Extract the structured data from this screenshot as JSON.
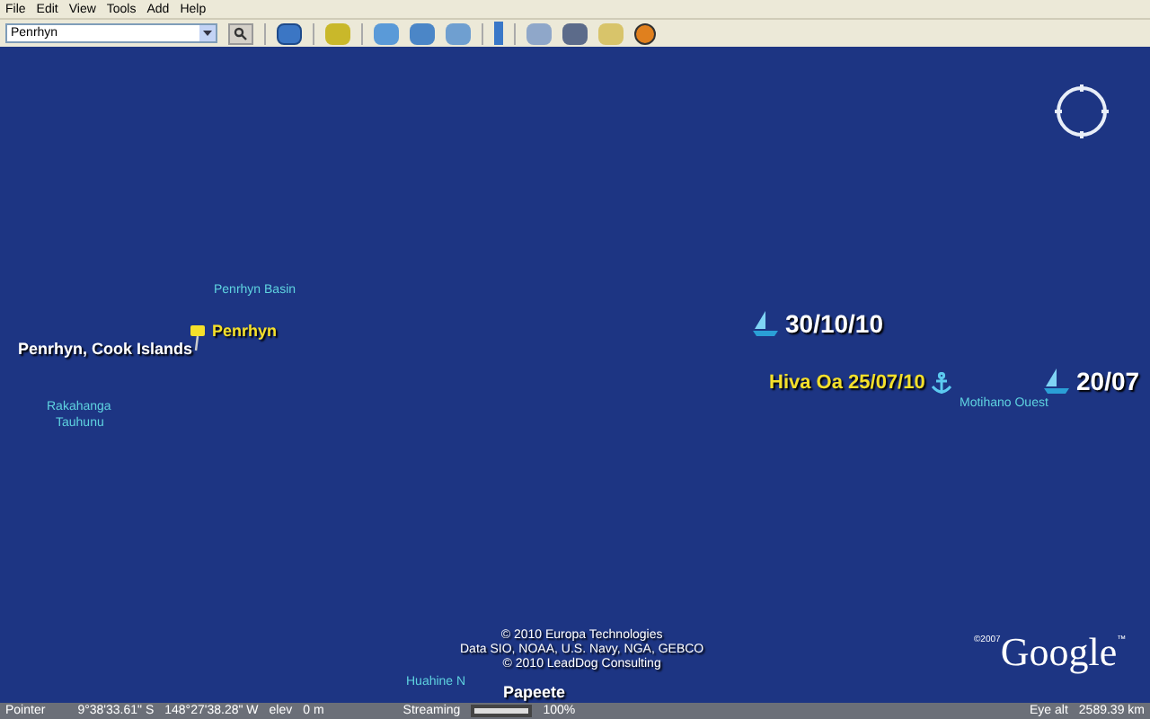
{
  "menu": [
    "File",
    "Edit",
    "View",
    "Tools",
    "Add",
    "Help"
  ],
  "search": {
    "value": "Penrhyn"
  },
  "map": {
    "labels": [
      {
        "kind": "feature",
        "text": "Penrhyn Basin"
      },
      {
        "kind": "pin",
        "text": "Penrhyn"
      },
      {
        "kind": "place",
        "text": "Penrhyn, Cook Islands"
      },
      {
        "kind": "feature",
        "text": "Rakahanga"
      },
      {
        "kind": "feature",
        "text": "Tauhunu"
      },
      {
        "kind": "boat",
        "text": "30/10/10"
      },
      {
        "kind": "anchor",
        "text": "Hiva Oa 25/07/10"
      },
      {
        "kind": "feature",
        "text": "Motihano Ouest"
      },
      {
        "kind": "boat",
        "text": "20/07"
      },
      {
        "kind": "feature",
        "text": "Huahine N"
      },
      {
        "kind": "place",
        "text": "Papeete"
      }
    ],
    "copyright": [
      "© 2010 Europa Technologies",
      "Data SIO, NOAA, U.S. Navy, NGA, GEBCO",
      "© 2010 LeadDog Consulting"
    ],
    "logo": {
      "year": "©2007",
      "name": "Google",
      "tm": "™"
    }
  },
  "status_bar": {
    "pointer_label": "Pointer",
    "lat": "9°38'33.61\" S",
    "lon": "148°27'38.28\" W",
    "elev_label": "elev",
    "elev": "0 m",
    "streaming_label": "Streaming",
    "level": 1.0,
    "percent": "100%",
    "eye_label": "Eye alt",
    "eye_alt": "2589.39 km"
  }
}
